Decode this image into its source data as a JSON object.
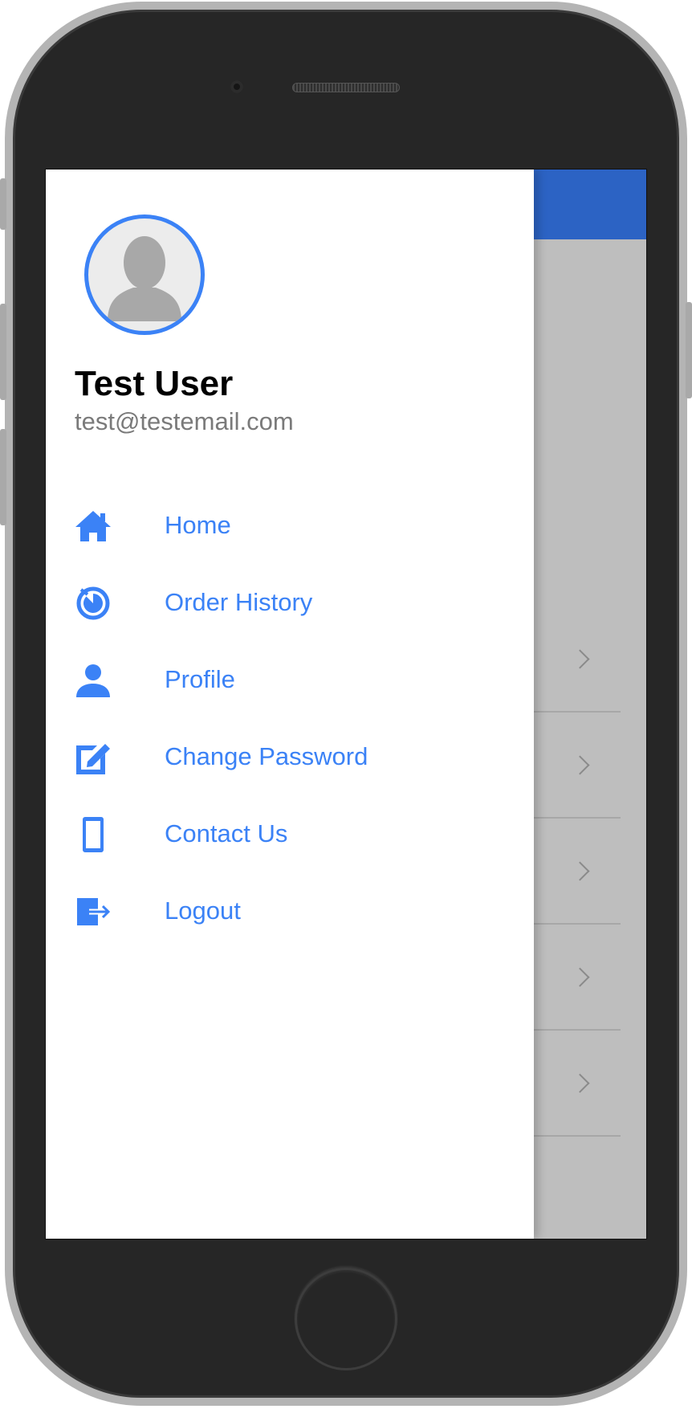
{
  "colors": {
    "accent": "#3b82f6",
    "appbar": "#2c63c4",
    "scrim": "#bebebe",
    "device_body": "#262626",
    "device_frame": "#b4b4b4"
  },
  "user": {
    "name": "Test User",
    "email": "test@testemail.com",
    "avatar_icon": "person-placeholder-icon"
  },
  "menu": {
    "items": [
      {
        "label": "Home",
        "icon": "home-icon"
      },
      {
        "label": "Order History",
        "icon": "history-icon"
      },
      {
        "label": "Profile",
        "icon": "person-icon"
      },
      {
        "label": "Change Password",
        "icon": "edit-icon"
      },
      {
        "label": "Contact Us",
        "icon": "phone-icon"
      },
      {
        "label": "Logout",
        "icon": "logout-icon"
      }
    ]
  },
  "background_list": {
    "row_count": 5,
    "row_icon": "chevron-right-icon"
  }
}
